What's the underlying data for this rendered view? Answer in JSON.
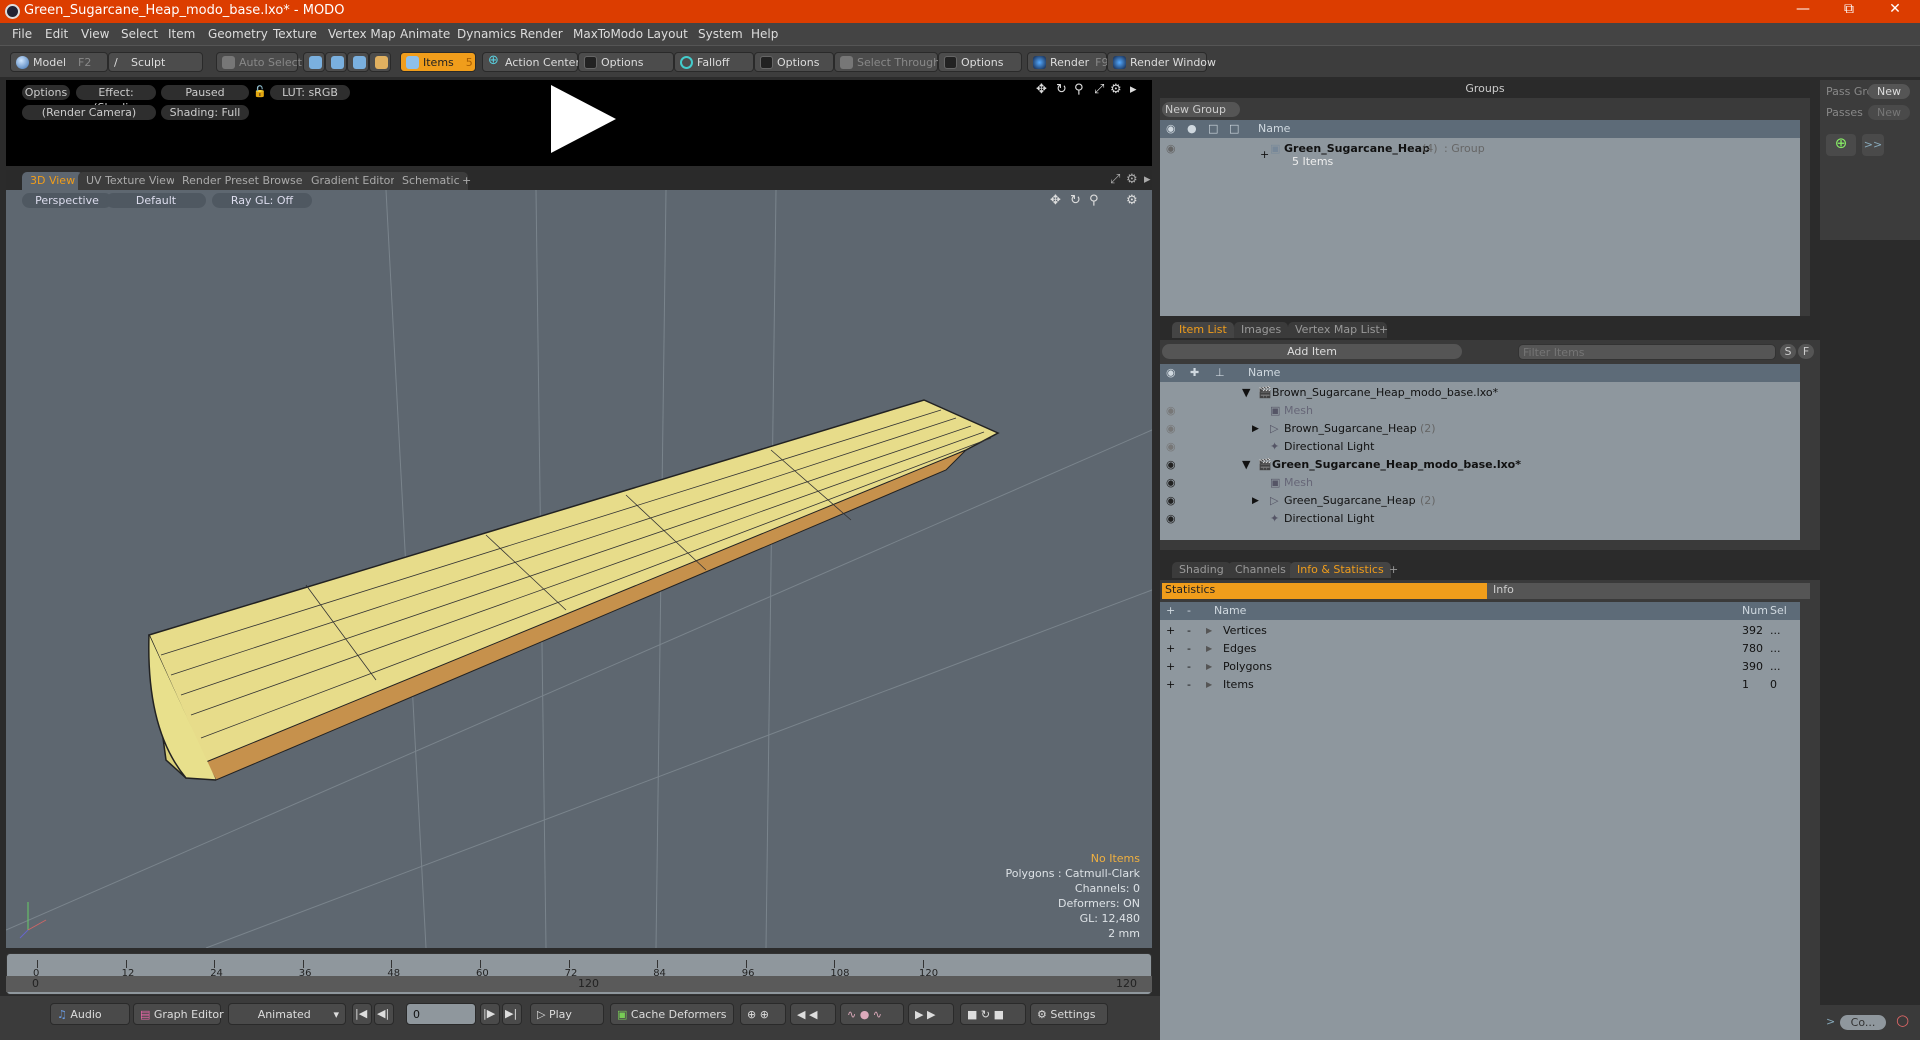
{
  "window": {
    "title": "Green_Sugarcane_Heap_modo_base.lxo* - MODO",
    "controls": [
      "minimize",
      "restore",
      "close"
    ]
  },
  "menu": [
    "File",
    "Edit",
    "View",
    "Select",
    "Item",
    "Geometry",
    "Texture",
    "Vertex Map",
    "Animate",
    "Dynamics",
    "Render",
    "MaxToModo",
    "Layout",
    "System",
    "Help"
  ],
  "toolbar": {
    "model": "Model",
    "model_shortcut": "F2",
    "sculpt": "Sculpt",
    "auto_select": "Auto Select",
    "items": "Items",
    "items_shortcut": "5",
    "action_center": "Action Center",
    "options1": "Options",
    "falloff": "Falloff",
    "options2": "Options",
    "select_through": "Select Through",
    "options3": "Options",
    "render": "Render",
    "render_shortcut": "F9",
    "render_window": "Render Window"
  },
  "preview": {
    "options": "Options",
    "effect": "Effect: (Shadi...",
    "paused": "Paused",
    "lut": "LUT: sRGB",
    "camera": "(Render Camera)",
    "shading": "Shading: Full"
  },
  "viewport_tabs": [
    "3D View",
    "UV Texture View",
    "Render Preset Browser",
    "Gradient Editor",
    "Schematic",
    "+"
  ],
  "viewport": {
    "projection": "Perspective",
    "style": "Default",
    "raygl": "Ray GL: Off",
    "stats": {
      "selection": "No Items",
      "polygons": "Polygons : Catmull-Clark",
      "channels": "Channels: 0",
      "deformers": "Deformers: ON",
      "gl": "GL: 12,480",
      "scale": "2 mm"
    }
  },
  "timeline": {
    "ticks": [
      "0",
      "12",
      "24",
      "36",
      "48",
      "60",
      "72",
      "84",
      "96",
      "108",
      "120"
    ],
    "range_start": "0",
    "range_mid": "120",
    "range_end": "120"
  },
  "bottom": {
    "audio": "Audio",
    "graph_editor": "Graph Editor",
    "animated": "Animated",
    "frame": "0",
    "play": "Play",
    "cache_deformers": "Cache Deformers",
    "settings": "Settings",
    "command": "Co..."
  },
  "groups": {
    "header": "Groups",
    "new_group": "New Group",
    "col_name": "Name",
    "item_name": "Green_Sugarcane_Heap",
    "item_count": "(4)",
    "item_type": ": Group",
    "item_sub": "5 Items"
  },
  "pass": {
    "pass_groups": "Pass Gro",
    "passes": "Passes",
    "new1": "New",
    "new2": "New",
    "forward": ">>"
  },
  "itemlist": {
    "tabs": [
      "Item List",
      "Images",
      "Vertex Map List",
      "+"
    ],
    "add_item": "Add Item",
    "filter_placeholder": "Filter Items",
    "s": "S",
    "f": "F",
    "col_name": "Name",
    "rows": [
      {
        "name": "Brown_Sugarcane_Heap_modo_base.lxo*",
        "count": "",
        "level": 0,
        "kind": "scene",
        "bold": false
      },
      {
        "name": "Mesh",
        "count": "",
        "level": 1,
        "kind": "mesh",
        "bold": false
      },
      {
        "name": "Brown_Sugarcane_Heap",
        "count": "(2)",
        "level": 1,
        "kind": "group",
        "bold": false
      },
      {
        "name": "Directional Light",
        "count": "",
        "level": 1,
        "kind": "light",
        "bold": false
      },
      {
        "name": "Green_Sugarcane_Heap_modo_base.lxo*",
        "count": "",
        "level": 0,
        "kind": "scene",
        "bold": true
      },
      {
        "name": "Mesh",
        "count": "",
        "level": 1,
        "kind": "mesh",
        "bold": false
      },
      {
        "name": "Green_Sugarcane_Heap",
        "count": "(2)",
        "level": 1,
        "kind": "group",
        "bold": false
      },
      {
        "name": "Directional Light",
        "count": "",
        "level": 1,
        "kind": "light",
        "bold": false
      }
    ]
  },
  "stats_panel": {
    "tabs": [
      "Shading",
      "Channels",
      "Info & Statistics",
      "+"
    ],
    "subtabs": [
      "Statistics",
      "Info"
    ],
    "cols": [
      "Name",
      "Num",
      "Sel"
    ],
    "rows": [
      {
        "name": "Vertices",
        "num": "392",
        "sel": "..."
      },
      {
        "name": "Edges",
        "num": "780",
        "sel": "..."
      },
      {
        "name": "Polygons",
        "num": "390",
        "sel": "..."
      },
      {
        "name": "Items",
        "num": "1",
        "sel": "0"
      }
    ]
  },
  "colors": {
    "accent": "#f09d1b",
    "titlebar": "#dc3d00"
  }
}
